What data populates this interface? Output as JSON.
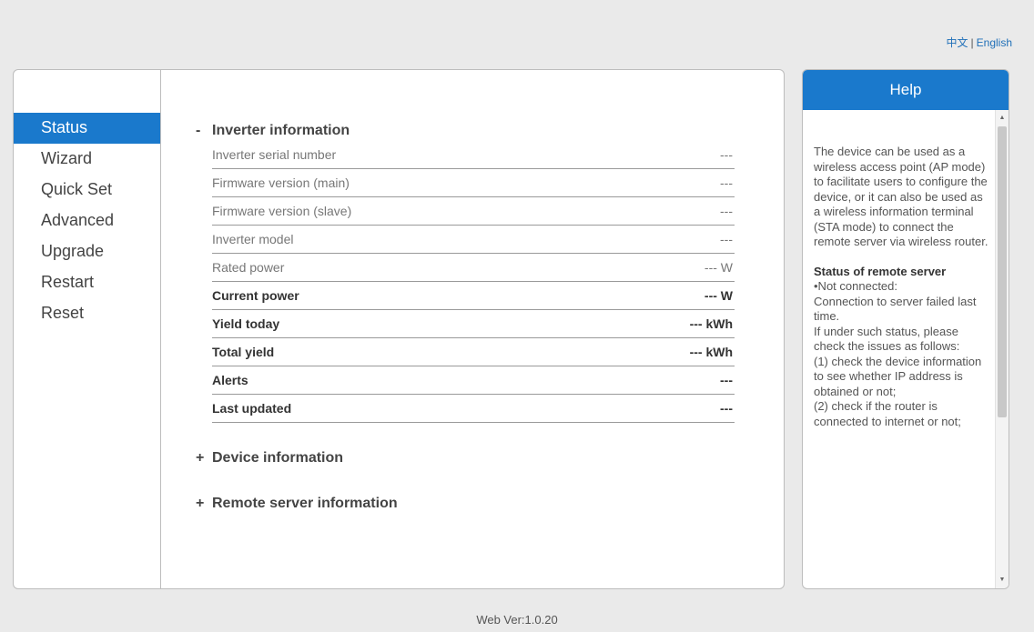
{
  "language": {
    "chinese": "中文",
    "separator": "|",
    "english": "English"
  },
  "sidebar": {
    "items": [
      {
        "label": "Status",
        "active": true
      },
      {
        "label": "Wizard"
      },
      {
        "label": "Quick Set"
      },
      {
        "label": "Advanced"
      },
      {
        "label": "Upgrade"
      },
      {
        "label": "Restart"
      },
      {
        "label": "Reset"
      }
    ]
  },
  "inverter": {
    "sign": "-",
    "title": "Inverter information",
    "rows": [
      {
        "label": "Inverter serial number",
        "value": "---"
      },
      {
        "label": "Firmware version (main)",
        "value": "---"
      },
      {
        "label": "Firmware version (slave)",
        "value": "---"
      },
      {
        "label": "Inverter model",
        "value": "---"
      },
      {
        "label": "Rated power",
        "value": "--- W"
      },
      {
        "label": "Current power",
        "value": "--- W"
      },
      {
        "label": "Yield today",
        "value": "--- kWh"
      },
      {
        "label": "Total yield",
        "value": "--- kWh"
      },
      {
        "label": "Alerts",
        "value": "---"
      },
      {
        "label": "Last updated",
        "value": "---"
      }
    ]
  },
  "device_section": {
    "sign": "+",
    "title": "Device information"
  },
  "server_section": {
    "sign": "+",
    "title": "Remote server information"
  },
  "help": {
    "title": "Help",
    "intro": "The device can be used as a wireless access point (AP mode) to facilitate users to configure the device, or it can also be used as a wireless information terminal (STA mode) to connect the remote server via wireless router.",
    "subhead": "Status of remote server",
    "lines": [
      "•Not connected:",
      "Connection to server failed last time.",
      "If under such status, please check the issues as follows:",
      "(1) check the device information to see whether IP address is obtained or not;",
      "(2) check if the router is connected to internet or not;"
    ],
    "scroll_up": "▲",
    "scroll_down": "▼"
  },
  "footer": {
    "version": "Web Ver:1.0.20"
  }
}
